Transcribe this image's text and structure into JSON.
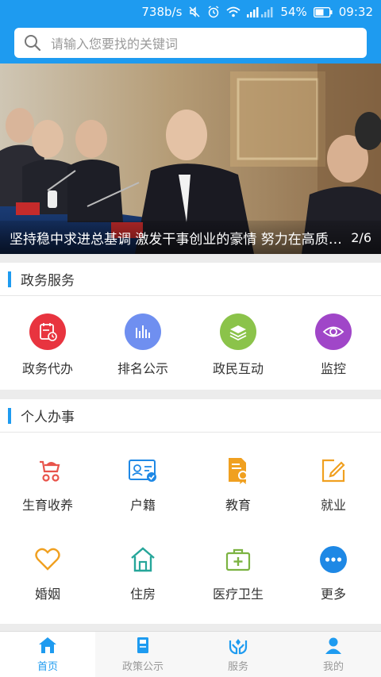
{
  "statusbar": {
    "speed": "738b/s",
    "battery": "54%",
    "time": "09:32"
  },
  "search": {
    "placeholder": "请输入您要找的关键词"
  },
  "banner": {
    "caption": "坚持稳中求进总基调 激发干事创业的豪情 努力在高质量发展上走在前列",
    "counter": "2/6"
  },
  "gov_services": {
    "title": "政务服务",
    "items": [
      {
        "label": "政务代办",
        "icon": "calendar-clock-icon",
        "color": "#e8343f"
      },
      {
        "label": "排名公示",
        "icon": "bar-chart-icon",
        "color": "#6f8ff0"
      },
      {
        "label": "政民互动",
        "icon": "layers-icon",
        "color": "#8bc34a"
      },
      {
        "label": "监控",
        "icon": "eye-icon",
        "color": "#a046c8"
      }
    ]
  },
  "personal": {
    "title": "个人办事",
    "items": [
      {
        "label": "生育收养",
        "icon": "baby-stroller-icon",
        "color": "#e8534a"
      },
      {
        "label": "户籍",
        "icon": "id-card-icon",
        "color": "#1e88e5"
      },
      {
        "label": "教育",
        "icon": "certificate-icon",
        "color": "#f0a020"
      },
      {
        "label": "就业",
        "icon": "edit-icon",
        "color": "#f0a020"
      },
      {
        "label": "婚姻",
        "icon": "heart-icon",
        "color": "#f0a020"
      },
      {
        "label": "住房",
        "icon": "house-icon",
        "color": "#26a69a"
      },
      {
        "label": "医疗卫生",
        "icon": "medical-kit-icon",
        "color": "#7cb342"
      },
      {
        "label": "更多",
        "icon": "more-icon",
        "color": "#1e88e5"
      }
    ]
  },
  "tabs": [
    {
      "label": "首页",
      "icon": "home-icon",
      "active": true
    },
    {
      "label": "政策公示",
      "icon": "book-icon",
      "active": false
    },
    {
      "label": "服务",
      "icon": "service-hands-icon",
      "active": false
    },
    {
      "label": "我的",
      "icon": "user-icon",
      "active": false
    }
  ]
}
